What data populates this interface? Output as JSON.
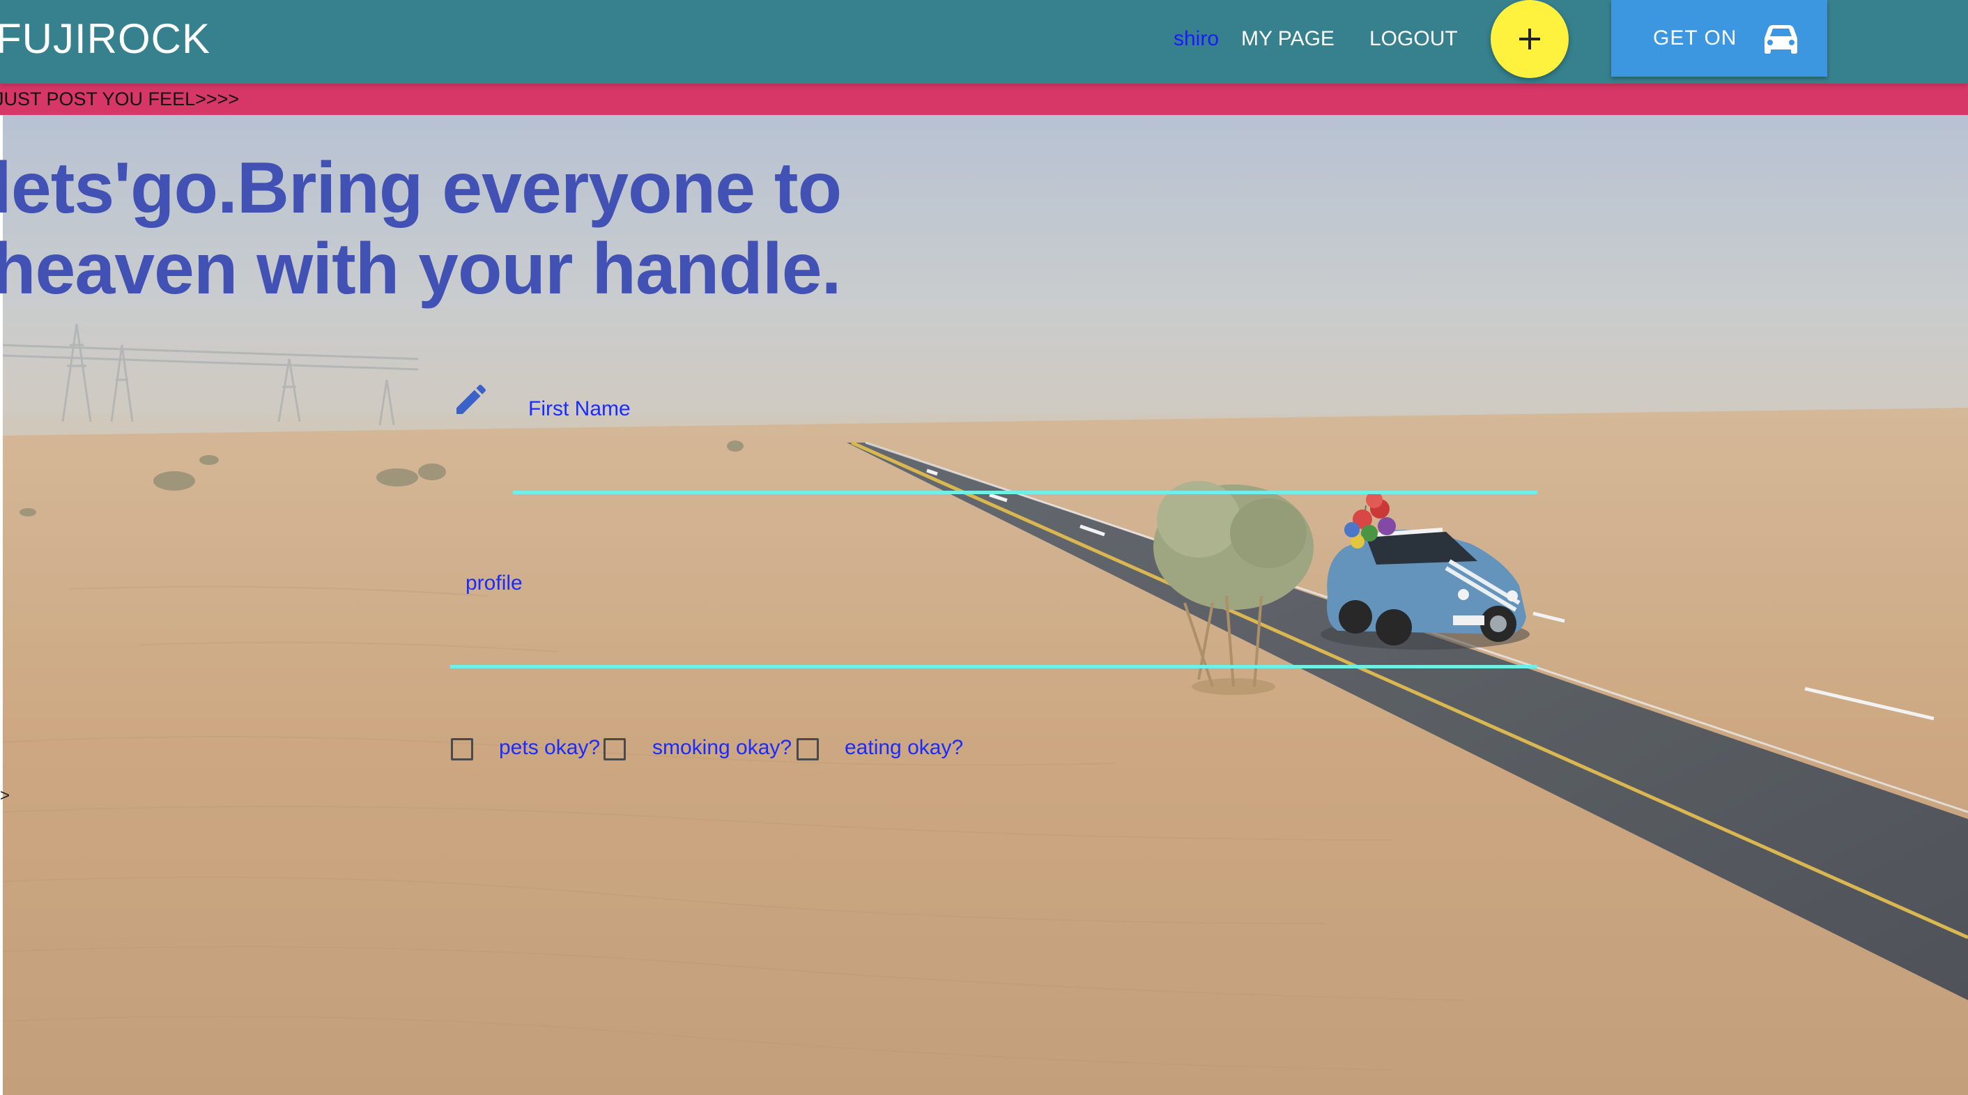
{
  "navbar": {
    "brand": "FUJIROCK",
    "username": "shiro",
    "my_page_label": "MY PAGE",
    "logout_label": "LOGOUT",
    "add_icon": "plus-icon",
    "get_on_label": "GET ON",
    "get_on_icon": "car-icon"
  },
  "ticker": {
    "text": "JUST POST YOU FEEL>>>>"
  },
  "hero": {
    "headline_line1": "lets'go.Bring everyone to",
    "headline_line2": "heaven with your handle."
  },
  "edge_glyph": ">",
  "form": {
    "name_icon": "pencil-icon",
    "first_name_label": "First Name",
    "first_name_value": "",
    "profile_label": "profile",
    "profile_value": "",
    "checkboxes": [
      {
        "label": "pets okay?",
        "checked": false
      },
      {
        "label": "smoking okay?",
        "checked": false
      },
      {
        "label": "eating okay?",
        "checked": false
      }
    ]
  },
  "colors": {
    "navbar": "#37818e",
    "ticker": "#d63766",
    "headline": "#4251b4",
    "form_text": "#1a2bff",
    "underline": "#6ef0e6",
    "add_button": "#fff23f",
    "get_on_button": "#3d97e0"
  }
}
